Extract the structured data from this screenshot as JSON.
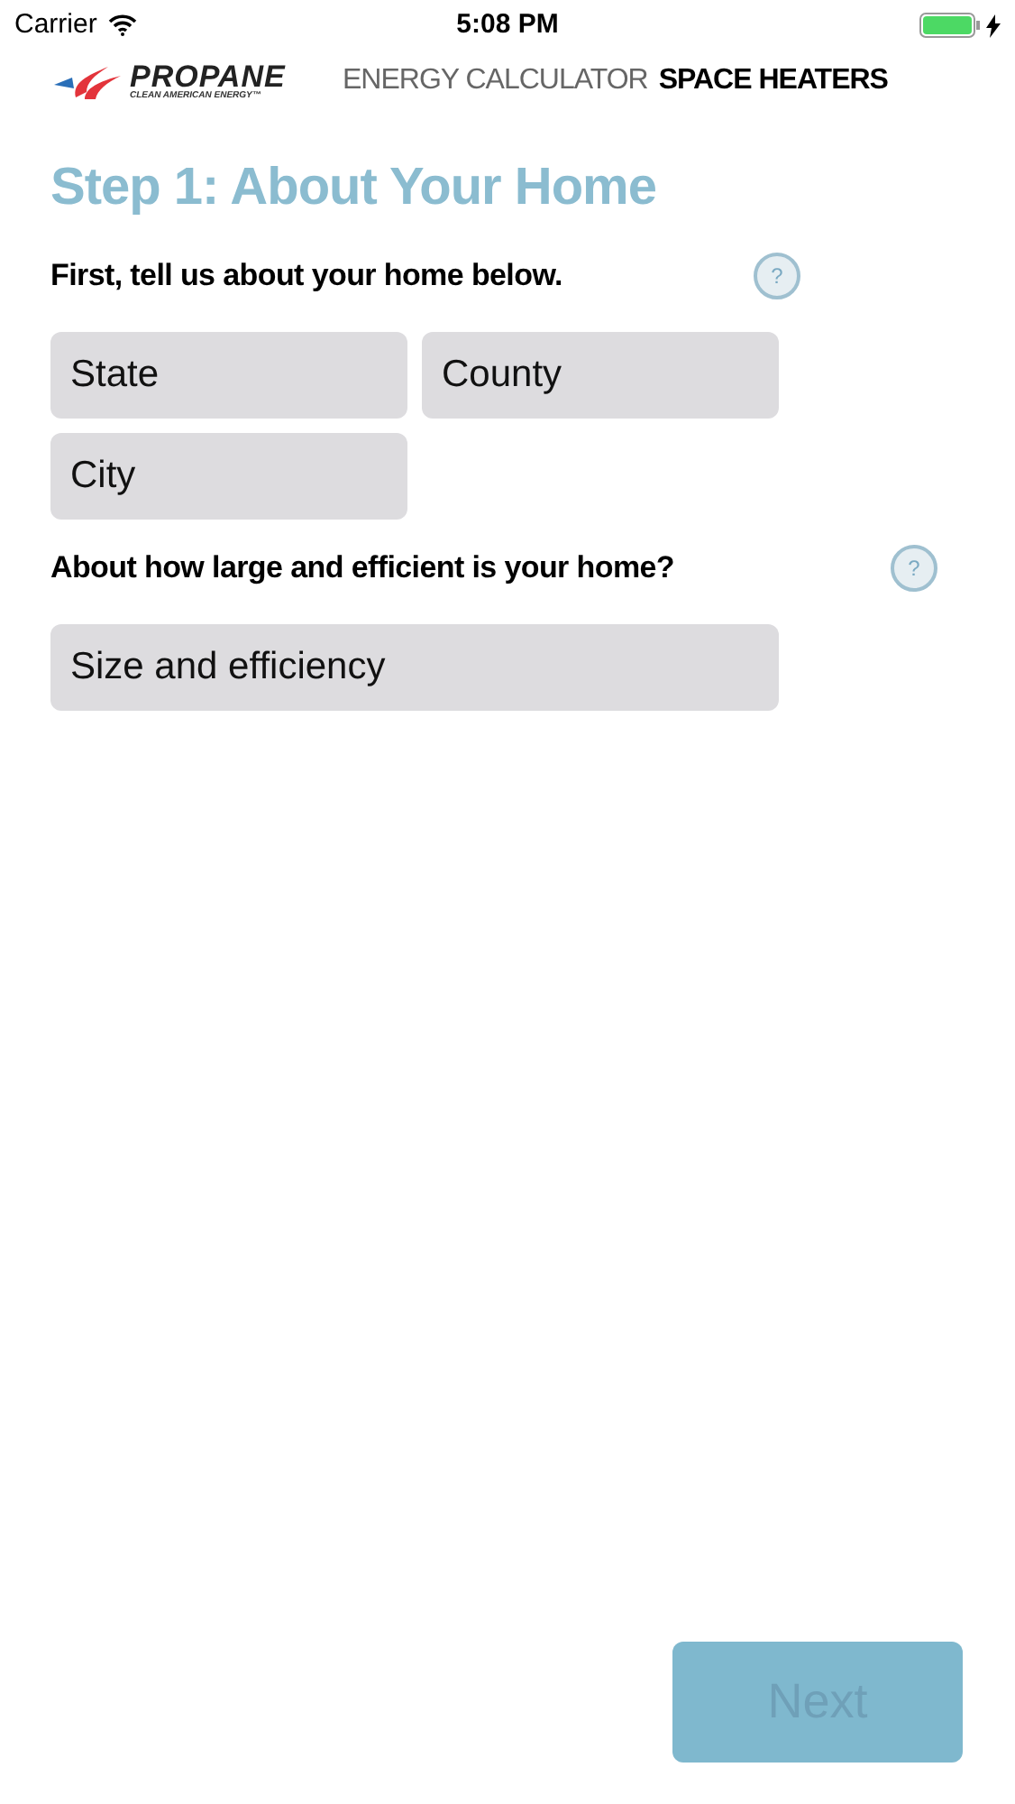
{
  "status_bar": {
    "carrier": "Carrier",
    "time": "5:08 PM",
    "charging": true
  },
  "header": {
    "logo_name": "PROPANE",
    "logo_tagline": "CLEAN AMERICAN ENERGY™",
    "title": "ENERGY CALCULATOR",
    "subtitle": "SPACE HEATERS"
  },
  "step_title": "Step 1: About Your Home",
  "sections": [
    {
      "question": "First, tell us about your home below.",
      "help": "?",
      "rows": [
        [
          {
            "placeholder": "State"
          },
          {
            "placeholder": "County"
          }
        ],
        [
          {
            "placeholder": "City"
          }
        ]
      ]
    },
    {
      "question": "About how large and efficient is your home?",
      "help": "?",
      "rows": [
        [
          {
            "placeholder": "Size and efficiency"
          }
        ]
      ]
    }
  ],
  "next_button": {
    "label": "Next",
    "disabled": true
  }
}
